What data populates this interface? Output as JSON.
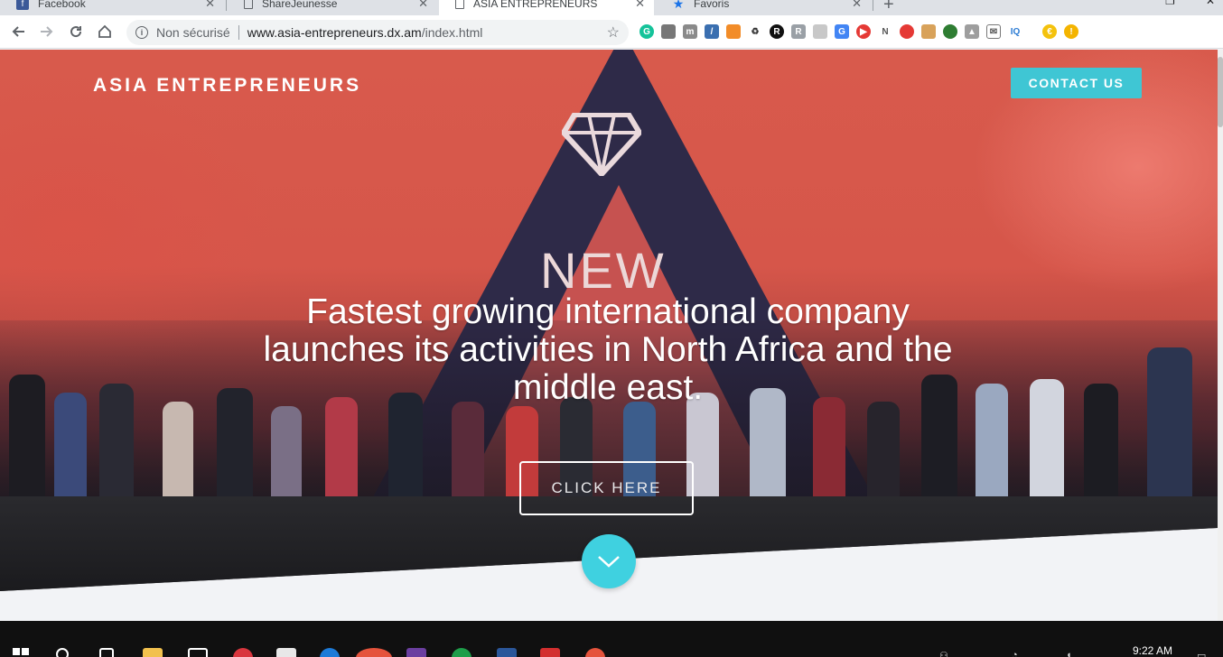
{
  "browser": {
    "tabs": [
      {
        "title": "Facebook",
        "active": false,
        "icon": "facebook-icon"
      },
      {
        "title": "ShareJeunesse",
        "active": false,
        "icon": "page-icon"
      },
      {
        "title": "ASIA ENTREPRENEURS",
        "active": true,
        "icon": "page-icon"
      },
      {
        "title": "Favoris",
        "active": false,
        "icon": "star-icon"
      }
    ],
    "security_label": "Non sécurisé",
    "url_host": "www.asia-entrepreneurs.dx.am",
    "url_path": "/index.html",
    "extensions": [
      "grammarly-icon",
      "monitor-icon",
      "archive-icon",
      "eyedropper-icon",
      "banner-icon",
      "recycle-icon",
      "r-icon",
      "rating-icon",
      "chat-icon",
      "translate-icon",
      "play-icon",
      "nt-icon",
      "trash-icon",
      "calendar-icon",
      "globe-icon",
      "drive-icon",
      "mail-icon",
      "iq-icon",
      "coin-icon",
      "alert-icon"
    ]
  },
  "site": {
    "brand": "ASIA ENTREPRENEURS",
    "contact_label": "CONTACT US",
    "hero_sign": "NEW",
    "headline": "Fastest growing international company launches its activities in North Africa and the middle east.",
    "cta_label": "CLICK HERE"
  },
  "taskbar": {
    "clock": "9:22 AM"
  },
  "colors": {
    "accent": "#3fc6d4",
    "scroll_button": "#3fd1e0",
    "hero_red": "#d6564a",
    "page_bg": "#f2f3f6"
  }
}
